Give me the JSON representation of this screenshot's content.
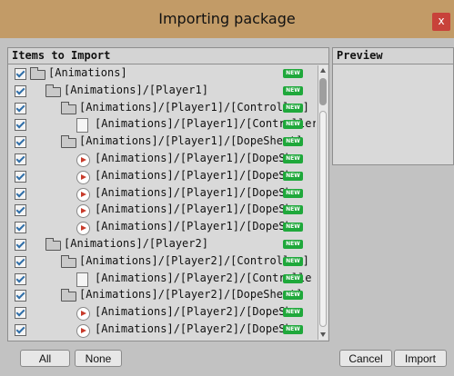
{
  "window": {
    "title": "Importing package",
    "close_label": "x"
  },
  "items_panel": {
    "header": "Items to Import"
  },
  "preview_panel": {
    "header": "Preview"
  },
  "badge_text": "NEW",
  "rows": [
    {
      "label": "[Animations]",
      "indent": 0,
      "icon": "folder-icon",
      "badge": true
    },
    {
      "label": "[Animations]/[Player1]",
      "indent": 1,
      "icon": "folder-icon",
      "badge": true
    },
    {
      "label": "[Animations]/[Player1]/[Controller]",
      "indent": 2,
      "icon": "folder-icon",
      "badge": true
    },
    {
      "label": "[Animations]/[Player1]/[Controller]",
      "indent": 3,
      "icon": "file-icon",
      "badge": true
    },
    {
      "label": "[Animations]/[Player1]/[DopeSheet]",
      "indent": 2,
      "icon": "folder-icon",
      "badge": true
    },
    {
      "label": "[Animations]/[Player1]/[DopeShe",
      "indent": 3,
      "icon": "animation-clip-icon",
      "badge": true
    },
    {
      "label": "[Animations]/[Player1]/[DopeShe",
      "indent": 3,
      "icon": "animation-clip-icon",
      "badge": true
    },
    {
      "label": "[Animations]/[Player1]/[DopeShe",
      "indent": 3,
      "icon": "animation-clip-icon",
      "badge": true
    },
    {
      "label": "[Animations]/[Player1]/[DopeShe",
      "indent": 3,
      "icon": "animation-clip-icon",
      "badge": true
    },
    {
      "label": "[Animations]/[Player1]/[DopeShe",
      "indent": 3,
      "icon": "animation-clip-icon",
      "badge": true
    },
    {
      "label": "[Animations]/[Player2]",
      "indent": 1,
      "icon": "folder-icon",
      "badge": true
    },
    {
      "label": "[Animations]/[Player2]/[Controller]",
      "indent": 2,
      "icon": "folder-icon",
      "badge": true
    },
    {
      "label": "[Animations]/[Player2]/[Controlle",
      "indent": 3,
      "icon": "file-icon",
      "badge": true
    },
    {
      "label": "[Animations]/[Player2]/[DopeSheet]",
      "indent": 2,
      "icon": "folder-icon",
      "badge": true
    },
    {
      "label": "[Animations]/[Player2]/[DopeShe",
      "indent": 3,
      "icon": "animation-clip-icon",
      "badge": true
    },
    {
      "label": "[Animations]/[Player2]/[DopeShe",
      "indent": 3,
      "icon": "animation-clip-icon",
      "badge": true
    }
  ],
  "buttons": {
    "all": "All",
    "none": "None",
    "cancel": "Cancel",
    "import": "Import"
  }
}
